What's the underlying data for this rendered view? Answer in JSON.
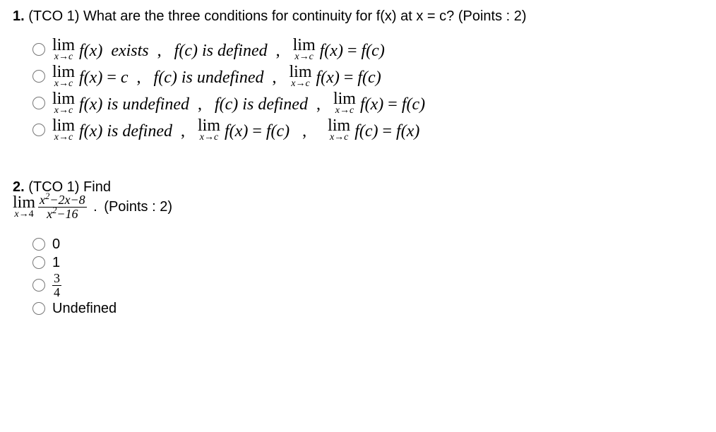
{
  "q1": {
    "number": "1.",
    "tag": "(TCO 1)",
    "prompt": "What are the three conditions for continuity for f(x) at x = c?",
    "points": "(Points : 2)",
    "options": [
      {
        "part1": "exists",
        "part2_word": "defined",
        "part3": "= f(c)"
      },
      {
        "part1": "= c",
        "part2_word": "undefined",
        "part3": "= f(c)"
      },
      {
        "part1": "is undefined",
        "part2_word": "defined",
        "part3": "= f(c)"
      },
      {
        "part1": "is defined",
        "alt": true
      }
    ],
    "fc_label": "f(c)",
    "fx_label": "f(x)",
    "is_label": "is",
    "lim_label": "lim",
    "lim_sub": "x→c",
    "comma": ","
  },
  "q2": {
    "number": "2.",
    "tag": "(TCO 1)",
    "prompt_word": "Find",
    "lim_sub": "x→4",
    "numerator": "x²−2x−8",
    "denominator": "x²−16",
    "dot": ".",
    "points": "(Points : 2)",
    "opt0": "0",
    "opt1": "1",
    "opt2_num": "3",
    "opt2_den": "4",
    "opt3": "Undefined"
  }
}
